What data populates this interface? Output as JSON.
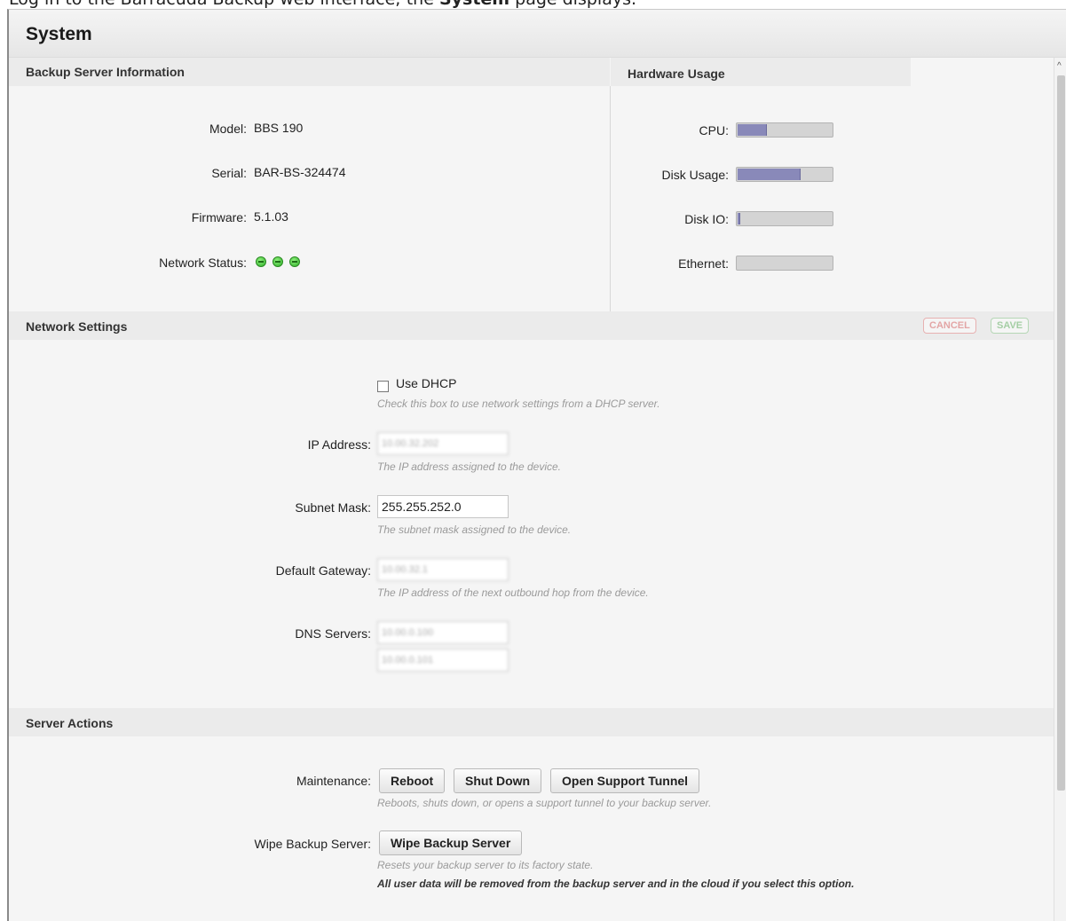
{
  "caption": {
    "prefix": "Log in to the Barracuda Backup web interface; the ",
    "bold": "System",
    "suffix": " page displays."
  },
  "page": {
    "title": "System"
  },
  "server_info": {
    "heading": "Backup Server Information",
    "model_label": "Model:",
    "model_value": "BBS 190",
    "serial_label": "Serial:",
    "serial_value": "BAR-BS-324474",
    "firmware_label": "Firmware:",
    "firmware_value": "5.1.03",
    "network_status_label": "Network Status:",
    "network_status_dots": 3,
    "status_color": "#2fae2a"
  },
  "hardware_usage": {
    "heading": "Hardware Usage",
    "meters": [
      {
        "label": "CPU:",
        "percent": 30
      },
      {
        "label": "Disk Usage:",
        "percent": 66
      },
      {
        "label": "Disk IO:",
        "percent": 2
      },
      {
        "label": "Ethernet:",
        "percent": 0
      }
    ],
    "fill_color": "#8989b9"
  },
  "network_settings": {
    "heading": "Network Settings",
    "cancel_label": "CANCEL",
    "save_label": "SAVE",
    "dhcp_label": "Use DHCP",
    "dhcp_checked": false,
    "dhcp_hint": "Check this box to use network settings from a DHCP server.",
    "ip_label": "IP Address:",
    "ip_value": "10.00.32.202",
    "ip_hint": "The IP address assigned to the device.",
    "subnet_label": "Subnet Mask:",
    "subnet_value": "255.255.252.0",
    "subnet_hint": "The subnet mask assigned to the device.",
    "gateway_label": "Default Gateway:",
    "gateway_value": "10.00.32.1",
    "gateway_hint": "The IP address of the next outbound hop from the device.",
    "dns_label": "DNS Servers:",
    "dns_primary": "10.00.0.100",
    "dns_secondary": "10.00.0.101"
  },
  "server_actions": {
    "heading": "Server Actions",
    "maintenance_label": "Maintenance:",
    "reboot_label": "Reboot",
    "shutdown_label": "Shut Down",
    "support_tunnel_label": "Open Support Tunnel",
    "maintenance_hint": "Reboots, shuts down, or opens a support tunnel to your backup server.",
    "wipe_label": "Wipe Backup Server:",
    "wipe_button_label": "Wipe Backup Server",
    "wipe_hint": "Resets your backup server to its factory state.",
    "wipe_warning": "All user data will be removed from the backup server and in the cloud if you select this option."
  }
}
